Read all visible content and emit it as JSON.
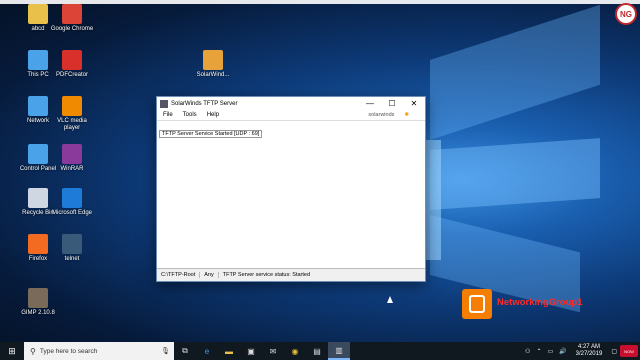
{
  "desktop_icons": [
    {
      "label": "abcd",
      "icon": "folder-icon",
      "color": "#e8c04a"
    },
    {
      "label": "Google Chrome",
      "icon": "chrome-icon",
      "color": "#db4437"
    },
    {
      "label": "This PC",
      "icon": "computer-icon",
      "color": "#4aa3e8"
    },
    {
      "label": "PDFCreator",
      "icon": "pdf-icon",
      "color": "#d9302b"
    },
    {
      "label": "SolarWind...",
      "icon": "solarwinds-icon",
      "color": "#e8a23a"
    },
    {
      "label": "Network",
      "icon": "network-icon",
      "color": "#4aa3e8"
    },
    {
      "label": "VLC media player",
      "icon": "vlc-icon",
      "color": "#f08a00"
    },
    {
      "label": "Control Panel",
      "icon": "control-panel-icon",
      "color": "#4aa3e8"
    },
    {
      "label": "WinRAR",
      "icon": "winrar-icon",
      "color": "#8a3a9a"
    },
    {
      "label": "Recycle Bin",
      "icon": "recycle-bin-icon",
      "color": "#cfd8e2"
    },
    {
      "label": "Microsoft Edge",
      "icon": "edge-icon",
      "color": "#1f7bd8"
    },
    {
      "label": "Firefox",
      "icon": "firefox-icon",
      "color": "#f36a21"
    },
    {
      "label": "telnet",
      "icon": "telnet-icon",
      "color": "#3a5a7a"
    },
    {
      "label": "GIMP 2.10.8",
      "icon": "gimp-icon",
      "color": "#7a6a5a"
    }
  ],
  "window": {
    "title": "SolarWinds TFTP Server",
    "minimize": "—",
    "maximize": "☐",
    "close": "✕",
    "menu": [
      "File",
      "Tools",
      "Help"
    ],
    "brand": "solarwinds",
    "log": "TFTP Server Service Started [UDP : 69]",
    "status": [
      "C:\\TFTP-Root",
      "Any",
      "TFTP Server service status: Started"
    ]
  },
  "watermark": {
    "text": "NetworkingGroup1",
    "logo_letter": "NG"
  },
  "taskbar": {
    "search_placeholder": "Type here to search",
    "time": "4:27 AM",
    "date": "3/27/2019",
    "live_badge": "NOW"
  }
}
